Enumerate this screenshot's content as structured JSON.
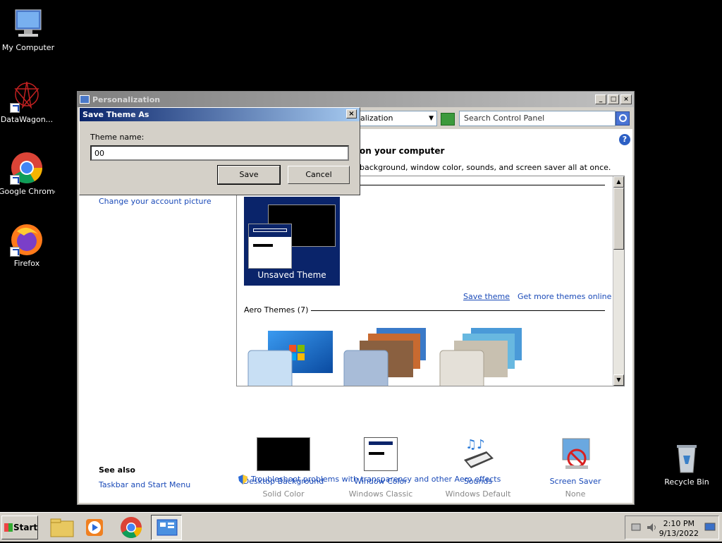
{
  "desktop": {
    "icons": [
      {
        "label": "My Computer"
      },
      {
        "label": "DataWagon..."
      },
      {
        "label": "Google Chrome"
      },
      {
        "label": "Firefox"
      },
      {
        "label": "Recycle Bin"
      }
    ]
  },
  "window": {
    "title": "Personalization",
    "address": "alization",
    "search_placeholder": "Search Control Panel",
    "heading": "on your computer",
    "description": "background, window color, sounds, and screen saver all at once.",
    "account_link": "Change your account picture",
    "see_also": "See also",
    "taskbar_link": "Taskbar and Start Menu",
    "themes": {
      "current_label": "Unsaved Theme",
      "save_theme": "Save theme",
      "get_more": "Get more themes online",
      "aero_header": "Aero Themes (7)"
    },
    "options": [
      {
        "title": "Desktop Background",
        "value": "Solid Color"
      },
      {
        "title": "Window Color",
        "value": "Windows Classic"
      },
      {
        "title": "Sounds",
        "value": "Windows Default"
      },
      {
        "title": "Screen Saver",
        "value": "None"
      }
    ],
    "troubleshoot": "Troubleshoot problems with transparency and other Aero effects"
  },
  "dialog": {
    "title": "Save Theme As",
    "label": "Theme name:",
    "value": "00",
    "save": "Save",
    "cancel": "Cancel"
  },
  "taskbar": {
    "start": "Start",
    "time": "2:10 PM",
    "date": "9/13/2022"
  },
  "colors": {
    "link": "#1a4ab8",
    "selection": "#0a246a"
  }
}
